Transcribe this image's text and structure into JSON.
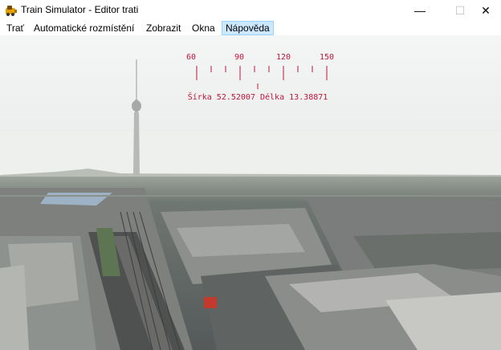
{
  "window": {
    "title": "Train Simulator - Editor trati",
    "minimize_symbol": "—",
    "maximize_symbol": "☐",
    "close_symbol": "✕",
    "app_icon": "train-icon"
  },
  "menu": {
    "items": [
      {
        "label": "Trať"
      },
      {
        "label": "Automatické rozmístění"
      },
      {
        "label": "Zobrazit"
      },
      {
        "label": "Okna"
      },
      {
        "label": "Nápověda"
      }
    ],
    "active_item": "Nápověda"
  },
  "hud": {
    "compass_ticks": [
      "60",
      "90",
      "120",
      "150"
    ],
    "coordinates": "Šírka 52.52007 Délka 13.38871",
    "color": "#c0143c"
  },
  "scene": {
    "description_icon": "3d-city-view"
  }
}
